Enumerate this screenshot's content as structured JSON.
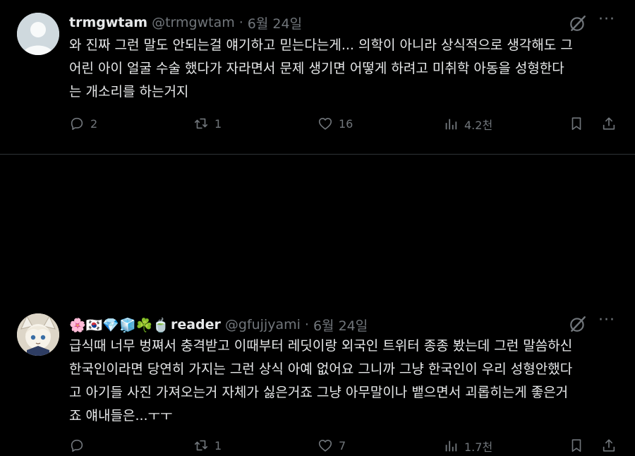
{
  "tweets": [
    {
      "name": "trmgwtam",
      "handle": "@trmgwtam",
      "separator": "·",
      "date": "6월 24일",
      "text": "와 진짜 그런 말도 안되는걸 얘기하고 믿는다는게... 의학이 아니라 상식적으로 생각해도 그\n어린 아이 얼굴 수술 했다가 자라면서 문제 생기면 어떻게 하려고 미취학 아동을 성형한다\n는 개소리를 하는거지",
      "more_label": "···",
      "replies": "2",
      "reposts": "1",
      "likes": "16",
      "views": "4.2천"
    },
    {
      "emojis": "🌸🇰🇷💎🧊☘️🍵",
      "name": "reader",
      "handle": "@gfujjyami",
      "separator": "·",
      "date": "6월 24일",
      "text": "급식때 너무 벙쪄서 충격받고 이때부터 레딧이랑 외국인 트위터 종종 봤는데 그런 말씀하신\n한국인이라면 당연히 가지는 그런 상식 아예 없어요 그니까 그냥 한국인이 우리 성형안했다\n고 아기들 사진 가져오는거 자체가 싫은거죠 그냥 아무말이나 뱉으면서 괴롭히는게 좋은거\n죠 얘내들은...ㅜㅜ",
      "more_label": "···",
      "replies": "",
      "reposts": "1",
      "likes": "7",
      "views": "1.7천"
    }
  ],
  "colors": {
    "background": "#000000",
    "text": "#e7e9ea",
    "secondary": "#71767b",
    "divider": "#2f3336"
  }
}
